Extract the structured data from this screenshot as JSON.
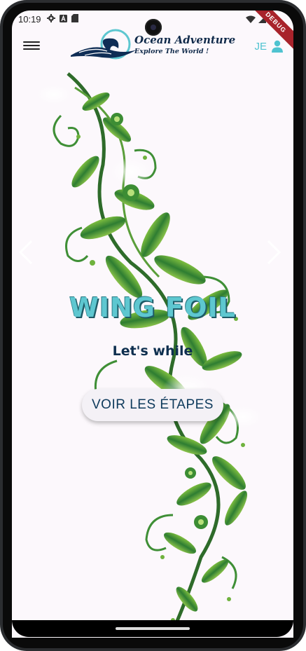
{
  "status_bar": {
    "time": "10:19",
    "icons_left": [
      "gear-icon",
      "a-icon",
      "sd-card-icon"
    ],
    "icons_right": [
      "wifi-icon",
      "signal-icon",
      "battery-icon"
    ],
    "debug_banner": "DEBUG"
  },
  "app_bar": {
    "logo_title": "Ocean Adventure",
    "logo_subtitle": "Explore The World !",
    "user_initials": "JE"
  },
  "hero": {
    "title": "WING FOIL",
    "subtitle": "Let's while",
    "cta_label": "VOIR LES ÉTAPES"
  },
  "colors": {
    "accent": "#4fc3d0",
    "navy": "#0e2f4f",
    "background": "#fcf8fc",
    "foliage_dark": "#2f7d32",
    "foliage_light": "#8bc34a"
  }
}
